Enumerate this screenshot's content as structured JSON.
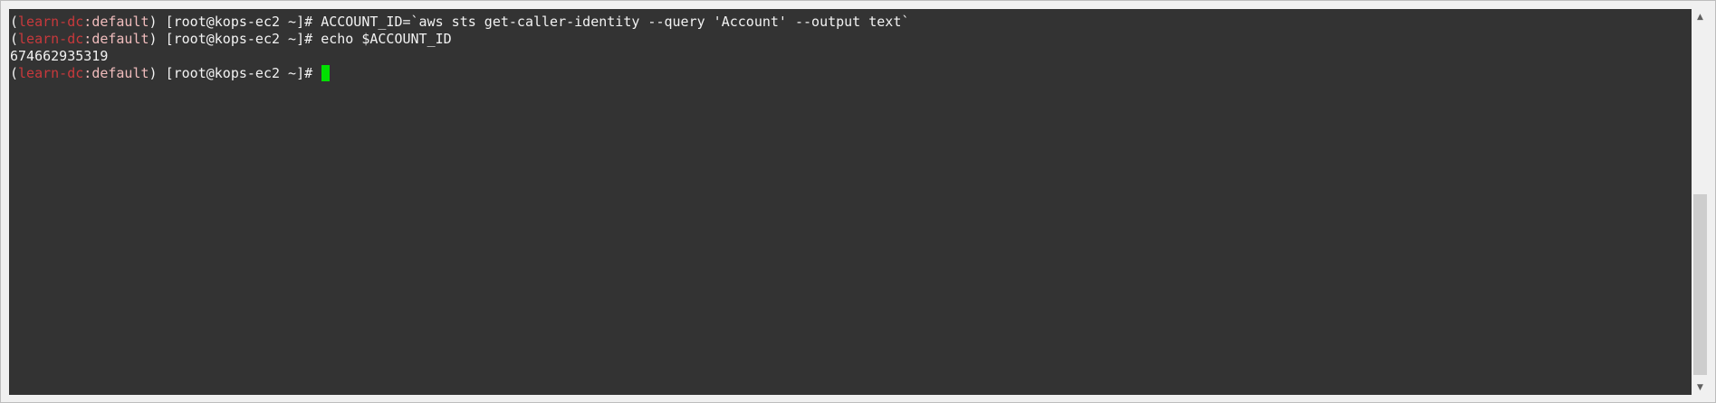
{
  "terminal": {
    "lines": [
      {
        "open": "(",
        "profile": "learn-dc",
        "colon": ":",
        "namespace": "default",
        "close": ") ",
        "host": "[root@kops-ec2 ~]# ",
        "command": "ACCOUNT_ID=`aws sts get-caller-identity --query 'Account' --output text`"
      },
      {
        "open": "(",
        "profile": "learn-dc",
        "colon": ":",
        "namespace": "default",
        "close": ") ",
        "host": "[root@kops-ec2 ~]# ",
        "command": "echo $ACCOUNT_ID"
      },
      {
        "output": "674662935319"
      },
      {
        "open": "(",
        "profile": "learn-dc",
        "colon": ":",
        "namespace": "default",
        "close": ") ",
        "host": "[root@kops-ec2 ~]# ",
        "command": ""
      }
    ]
  },
  "scrollbar": {
    "up_icon": "▲",
    "down_icon": "▼"
  },
  "colors": {
    "background": "#333333",
    "text": "#f2f2f2",
    "profile": "#c8393c",
    "cursor": "#00e000"
  }
}
